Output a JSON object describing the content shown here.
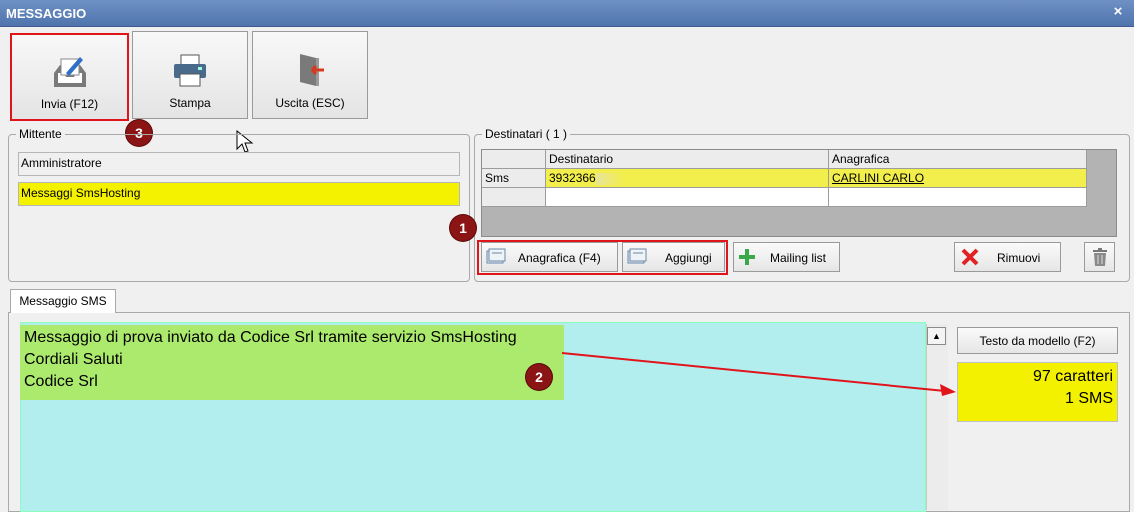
{
  "window": {
    "title": "MESSAGGIO",
    "close_glyph": "×"
  },
  "toolbar": {
    "send_label": "Invia (F12)",
    "print_label": "Stampa",
    "exit_label": "Uscita (ESC)"
  },
  "sender": {
    "group_title": "Mittente",
    "user": "Amministratore",
    "sender_name": "Messaggi SmsHosting"
  },
  "recipients": {
    "group_title": "Destinatari ( 1 )",
    "columns": [
      "Destinatario",
      "Anagrafica"
    ],
    "rows": [
      {
        "type": "Sms",
        "number": "3932366",
        "registry": "CARLINI CARLO"
      }
    ],
    "buttons": {
      "registry": "Anagrafica (F4)",
      "add": "Aggiungi",
      "mailing": "Mailing list",
      "remove": "Rimuovi"
    }
  },
  "message": {
    "tab_label": "Messaggio SMS",
    "text": "Messaggio di prova inviato da Codice Srl tramite servizio SmsHosting\nCordiali Saluti\nCodice Srl",
    "template_button": "Testo da modello (F2)",
    "char_count": "97 caratteri",
    "sms_count": "1 SMS"
  },
  "annotations": {
    "badge1": "1",
    "badge2": "2",
    "badge3": "3"
  },
  "colors": {
    "highlight_red": "#e0141b",
    "field_yellow": "#f5f200",
    "message_bg": "#b3eeee",
    "message_text_bg": "#acea6e"
  }
}
